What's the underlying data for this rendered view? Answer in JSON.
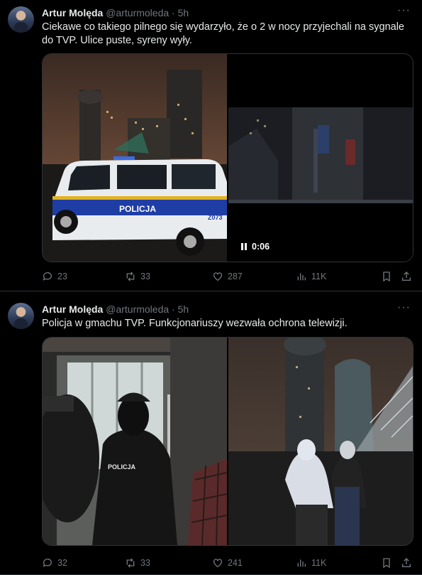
{
  "tweets": [
    {
      "author_name": "Artur Molęda",
      "handle": "@arturmoleda",
      "separator": "·",
      "time": "5h",
      "text": "Ciekawe co takiego pilnego się wydarzyło, że o 2 w nocy przyjechali na sygnale do TVP. Ulice puste, syreny wyły.",
      "van_label": "POLICJA",
      "van_plate": "Z073",
      "video_duration": "0:06",
      "replies": "23",
      "reposts": "33",
      "likes": "287",
      "views": "11K"
    },
    {
      "author_name": "Artur Molęda",
      "handle": "@arturmoleda",
      "separator": "·",
      "time": "5h",
      "text": "Policja w gmachu TVP. Funkcjonariuszy wezwała ochrona telewizji.",
      "officer_label": "POLICJA",
      "replies": "32",
      "reposts": "33",
      "likes": "241",
      "views": "11K"
    }
  ],
  "icons": [
    "reply-icon",
    "repost-icon",
    "like-icon",
    "views-icon",
    "bookmark-icon",
    "share-icon",
    "more-icon",
    "pause-icon"
  ]
}
